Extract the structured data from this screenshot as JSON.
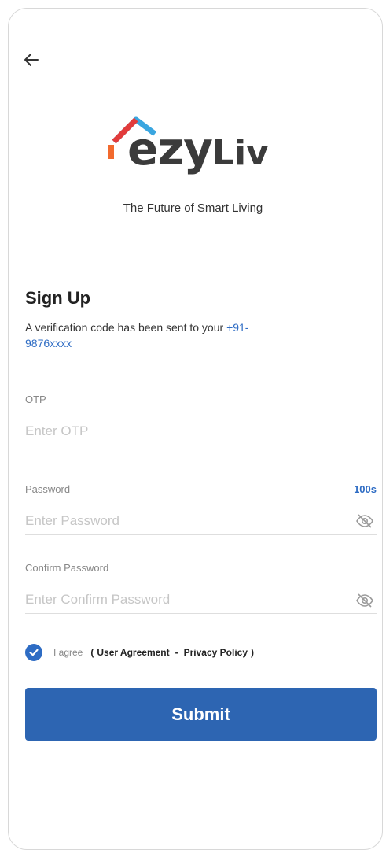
{
  "app": {
    "brand_main": "ezy",
    "brand_suffix": "Liv",
    "tagline": "The Future of Smart Living"
  },
  "header": {
    "back_icon": "arrow-left-icon"
  },
  "form": {
    "title": "Sign Up",
    "subtitle_text": "A verification code has been sent to your",
    "phone_number": "+91-9876xxxx",
    "otp": {
      "label": "OTP",
      "placeholder": "Enter OTP",
      "timer": "100s"
    },
    "password": {
      "label": "Password",
      "placeholder": "Enter Password",
      "toggle_icon": "eye-off-icon"
    },
    "confirm_password": {
      "label": "Confirm Password",
      "placeholder": "Enter Confirm Password",
      "toggle_icon": "eye-off-icon"
    },
    "agree": {
      "checked": true,
      "text": "I agree",
      "open_paren": "(",
      "user_agreement": "User Agreement",
      "separator": "-",
      "privacy_policy": "Privacy Policy",
      "close_paren": ")"
    },
    "submit_label": "Submit"
  },
  "colors": {
    "accent": "#2d65b2",
    "link": "#2e6cc4",
    "logo_orange": "#f26a2e",
    "logo_blue": "#3aa6e0",
    "logo_red": "#e23b3b"
  }
}
